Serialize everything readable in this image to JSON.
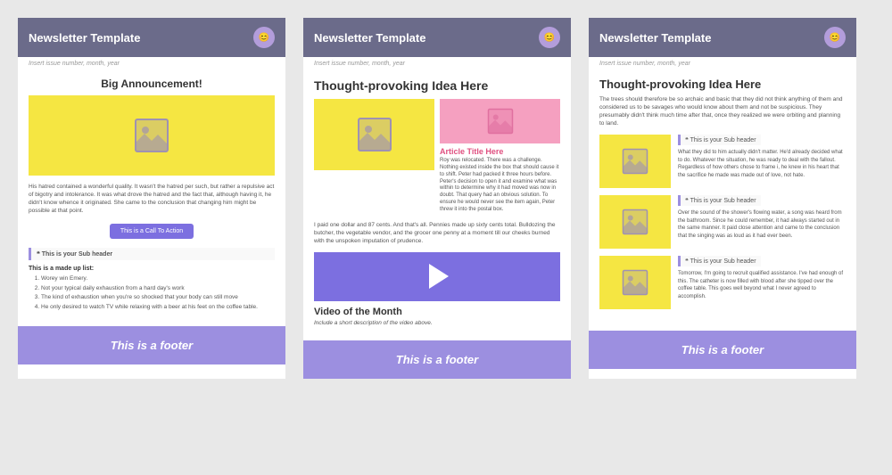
{
  "templates": [
    {
      "id": "template-1",
      "header": {
        "title": "Newsletter Template",
        "avatar_icon": "👤"
      },
      "issue_line": "Insert issue number, month, year",
      "big_announcement": "Big Announcement!",
      "main_image_alt": "main image placeholder",
      "body_text": "His hatred contained a wonderful quality. It wasn't the hatred per such, but rather a repulsive act of bigotry and intolerance. It was what drove the hatred and the fact that, although having it, he didn't know whence it originated. She came to the conclusion that changing him might be possible at that point.",
      "cta_button": "This is a Call To Action",
      "subheader_label": "This is your Sub header",
      "list_title": "This is a made up list:",
      "list_items": [
        "Worey win Emery.",
        "Not your typical daily exhaustion from a hard day's work",
        "The kind of exhaustion when you're so shocked that your body can still move",
        "He only desired to watch TV while relaxing with a beer at his feet on the coffee table."
      ],
      "footer": "This is a footer"
    },
    {
      "id": "template-2",
      "header": {
        "title": "Newsletter Template",
        "avatar_icon": "👤"
      },
      "issue_line": "Insert issue number, month, year",
      "main_title": "Thought-provoking Idea Here",
      "main_text": "I paid one dollar and 87 cents. And that's all. Pennies made up sixty cents total. Bulldozing the butcher, the vegetable vendor, and the grocer one penny at a moment till our cheeks burned with the unspoken imputation of prudence.",
      "article_title": "Article Title Here",
      "article_text": "Roy was relocated. There was a challenge. Nothing existed inside the box that should cause it to shift. Peter had packed it three hours before. Peter's decision to open it and examine what was within to determine why it had moved was now in doubt. That query had an obvious solution. To ensure he would never see the item again, Peter threw it into the postal box.",
      "video_title": "Video of the Month",
      "video_desc": "Include a short description of the video above.",
      "footer": "This is a footer"
    },
    {
      "id": "template-3",
      "header": {
        "title": "Newsletter Template",
        "avatar_icon": "👤"
      },
      "issue_line": "Insert issue number, month, year",
      "main_title": "Thought-provoking Idea Here",
      "intro_text": "The trees should therefore be so archaic and basic that they did not think anything of them and considered us to be savages who would know about them and not be suspicious. They presumably didn't think much time after that, once they realized we were orbiting and planning to land.",
      "items": [
        {
          "subheader": "This is your Sub header",
          "text": "What they did to him actually didn't matter. He'd already decided what to do. Whatever the situation, he was ready to deal with the fallout. Regardless of how others chose to frame i, he knew in his heart that the sacrifice he made was made out of love, not hate."
        },
        {
          "subheader": "This is your Sub header",
          "text": "Over the sound of the shower's flowing water, a song was heard from the bathroom. Since he could remember, it had always started out in the same manner. It paid close attention and came to the conclusion that the singing was as loud as it had ever been."
        },
        {
          "subheader": "This is your Sub header",
          "text": "Tomorrow, I'm going to recruit qualified assistance. I've had enough of this. The catheter is now filled with blood after she tipped over the coffee table. This goes well beyond what I never agreed to accomplish."
        }
      ],
      "footer": "This is a footer"
    }
  ]
}
